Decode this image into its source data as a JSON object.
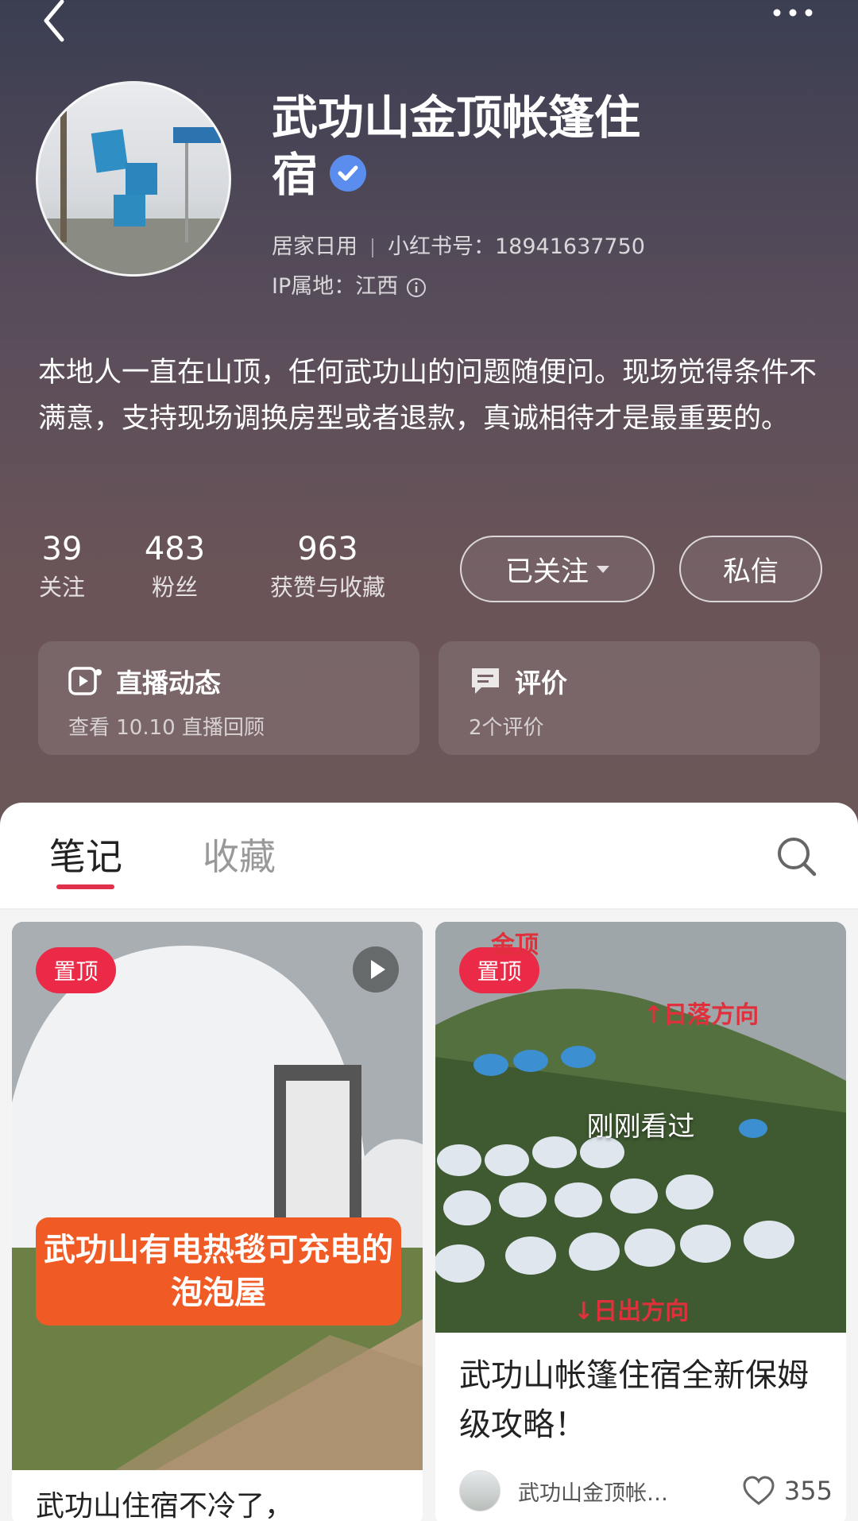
{
  "profile": {
    "name": "武功山金顶帐篷住宿",
    "category": "居家日用",
    "id_label": "小红书号：18941637750",
    "ip_label": "IP属地：江西",
    "bio": "本地人一直在山顶，任何武功山的问题随便问。现场觉得条件不满意，支持现场调换房型或者退款，真诚相待才是最重要的。"
  },
  "stats": [
    {
      "value": "39",
      "label": "关注"
    },
    {
      "value": "483",
      "label": "粉丝"
    },
    {
      "value": "963",
      "label": "获赞与收藏"
    }
  ],
  "actions": {
    "follow_label": "已关注",
    "message_label": "私信"
  },
  "cards": {
    "live": {
      "title": "直播动态",
      "subtitle": "查看 10.10 直播回顾"
    },
    "review": {
      "title": "评价",
      "subtitle": "2个评价"
    }
  },
  "tabs": {
    "notes": "笔记",
    "collections": "收藏"
  },
  "posts": [
    {
      "pinned_label": "置顶",
      "overlay_text": "武功山有电热毯可充电的泡泡屋",
      "title": "武功山住宿不冷了，"
    },
    {
      "pinned_label": "置顶",
      "image_labels": [
        "金顶",
        "↑日落方向",
        "↓日出方向"
      ],
      "seen_label": "刚刚看过",
      "title": "武功山帐篷住宿全新保姆级攻略！",
      "author": "武功山金顶帐…",
      "likes": "355"
    }
  ],
  "icons": [
    "back-icon",
    "more-icon",
    "verified-icon",
    "info-icon",
    "live-video-icon",
    "comment-icon",
    "search-icon",
    "play-icon",
    "heart-icon"
  ],
  "colors": {
    "accent": "#e0304a",
    "pin_badge": "#ea2a47",
    "verified": "#5b8def"
  }
}
